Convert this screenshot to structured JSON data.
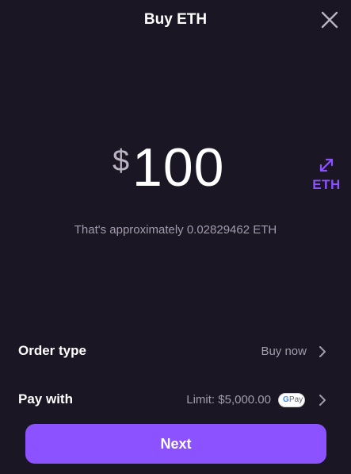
{
  "header": {
    "title": "Buy ETH",
    "close_icon": "close-icon"
  },
  "amount": {
    "currency_symbol": "$",
    "value": "100",
    "approximation": "That's approximately 0.02829462 ETH"
  },
  "swap": {
    "icon": "swap-arrows-icon",
    "label": "ETH"
  },
  "rows": [
    {
      "label": "Order type",
      "value": "Buy now"
    },
    {
      "label": "Pay with",
      "value": "Limit: $5,000.00",
      "badge": {
        "g": "G",
        "text": "Pay",
        "icon": "google-pay-icon"
      }
    }
  ],
  "next_button": {
    "label": "Next"
  },
  "colors": {
    "background": "#1a1623",
    "accent": "#8c52ff",
    "muted_text": "#a29cae"
  }
}
